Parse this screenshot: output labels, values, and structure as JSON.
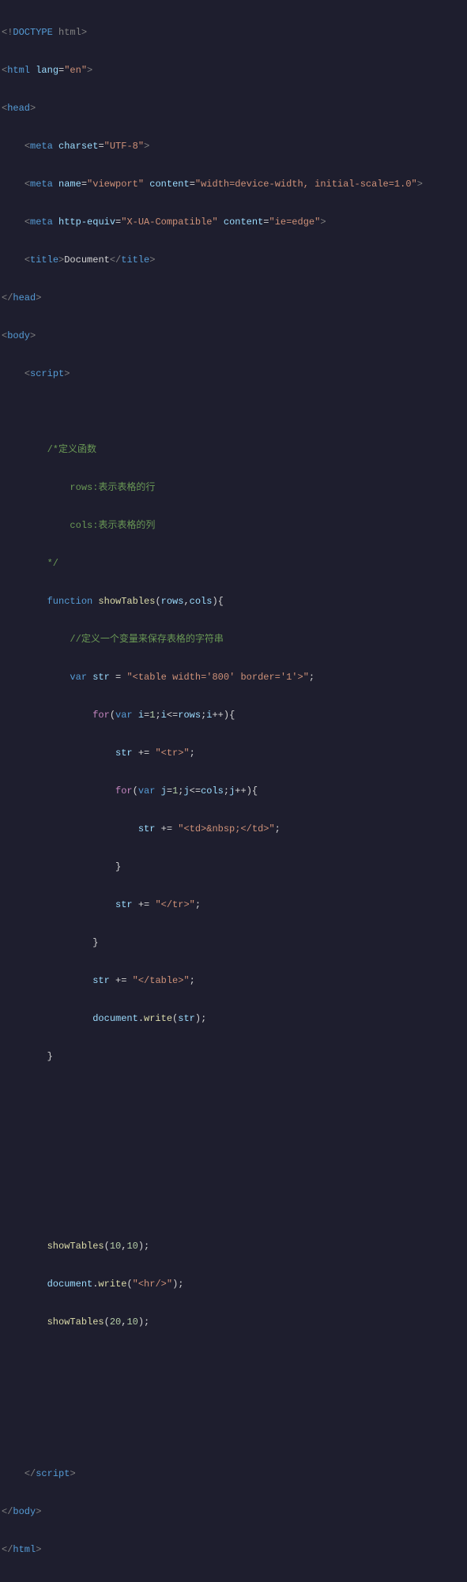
{
  "code": {
    "l01_doctype_excl": "!",
    "l01_doctype_word": "DOCTYPE",
    "l01_doctype_html": "html",
    "l02_html": "html",
    "l02_lang_attr": "lang",
    "l02_lang_val": "\"en\"",
    "l03_head": "head",
    "l04_meta": "meta",
    "l04_charset_attr": "charset",
    "l04_charset_val": "\"UTF-8\"",
    "l05_meta": "meta",
    "l05_name_attr": "name",
    "l05_name_val": "\"viewport\"",
    "l05_content_attr": "content",
    "l05_content_val": "\"width=device-width, initial-scale=1.0\"",
    "l06_meta": "meta",
    "l06_httpequiv_attr": "http-equiv",
    "l06_httpequiv_val": "\"X-UA-Compatible\"",
    "l06_content_attr": "content",
    "l06_content_val": "\"ie=edge\"",
    "l07_title": "title",
    "l07_title_text": "Document",
    "l08_head_close": "head",
    "l09_body": "body",
    "l10_script": "script",
    "l11_comment_open": "/*定义函数",
    "l12_comment_rows": "rows:表示表格的行",
    "l13_comment_cols": "cols:表示表格的列",
    "l14_comment_close": "*/",
    "l15_function": "function",
    "l15_fname": "showTables",
    "l15_p1": "rows",
    "l15_p2": "cols",
    "l16_comment": "//定义一个变量来保存表格的字符串",
    "l17_var": "var",
    "l17_str": "str",
    "l17_val": "\"<table width='800' border='1'>\"",
    "l18_for": "for",
    "l18_var": "var",
    "l18_i": "i",
    "l18_one": "1",
    "l18_rows": "rows",
    "l19_str": "str",
    "l19_tr": "\"<tr>\"",
    "l20_for": "for",
    "l20_var": "var",
    "l20_j": "j",
    "l20_one": "1",
    "l20_cols": "cols",
    "l21_str": "str",
    "l21_td": "\"<td>&nbsp;</td>\"",
    "l22_brace": "}",
    "l23_str": "str",
    "l23_trc": "\"</tr>\"",
    "l24_brace": "}",
    "l25_str": "str",
    "l25_tablec": "\"</table>\"",
    "l26_doc": "document",
    "l26_write": "write",
    "l26_strp": "str",
    "l27_brace": "}",
    "l28_st": "showTables",
    "l28_n10a": "10",
    "l28_n10b": "10",
    "l29_doc": "document",
    "l29_write": "write",
    "l29_hr": "\"<hr/>\"",
    "l30_st": "showTables",
    "l30_n20": "20",
    "l30_n10": "10",
    "l31_script": "script",
    "l32_body": "body",
    "l33_html": "html"
  }
}
